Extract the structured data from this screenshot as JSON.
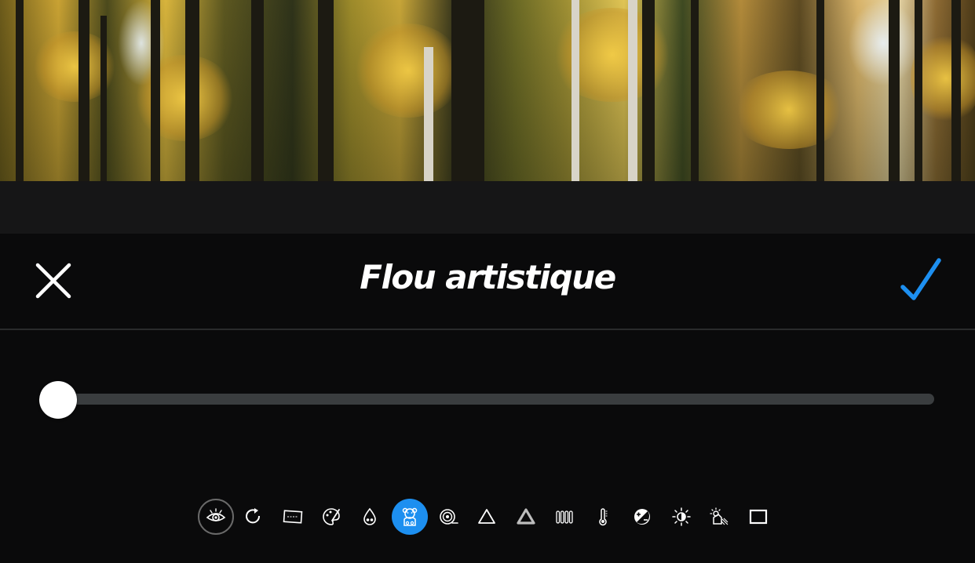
{
  "header": {
    "title": "Flou artistique",
    "close_icon": "close-icon",
    "confirm_icon": "checkmark-icon"
  },
  "slider": {
    "value": 0,
    "min": 0,
    "max": 1
  },
  "toolbar": {
    "selected": "bear-icon",
    "tools": [
      "eye-icon",
      "rotate-icon",
      "crop-icon",
      "palette-icon",
      "drops-icon",
      "bear-icon",
      "vignette-icon",
      "triangle-icon",
      "sharpen-triangle-icon",
      "bars-icon",
      "thermometer-icon",
      "exposure-icon",
      "sun-icon",
      "shadow-icon",
      "frame-icon"
    ]
  },
  "colors": {
    "accent": "#1d8ff0",
    "background": "#0a0a0b",
    "track": "#3a3d3f",
    "text": "#ffffff"
  }
}
